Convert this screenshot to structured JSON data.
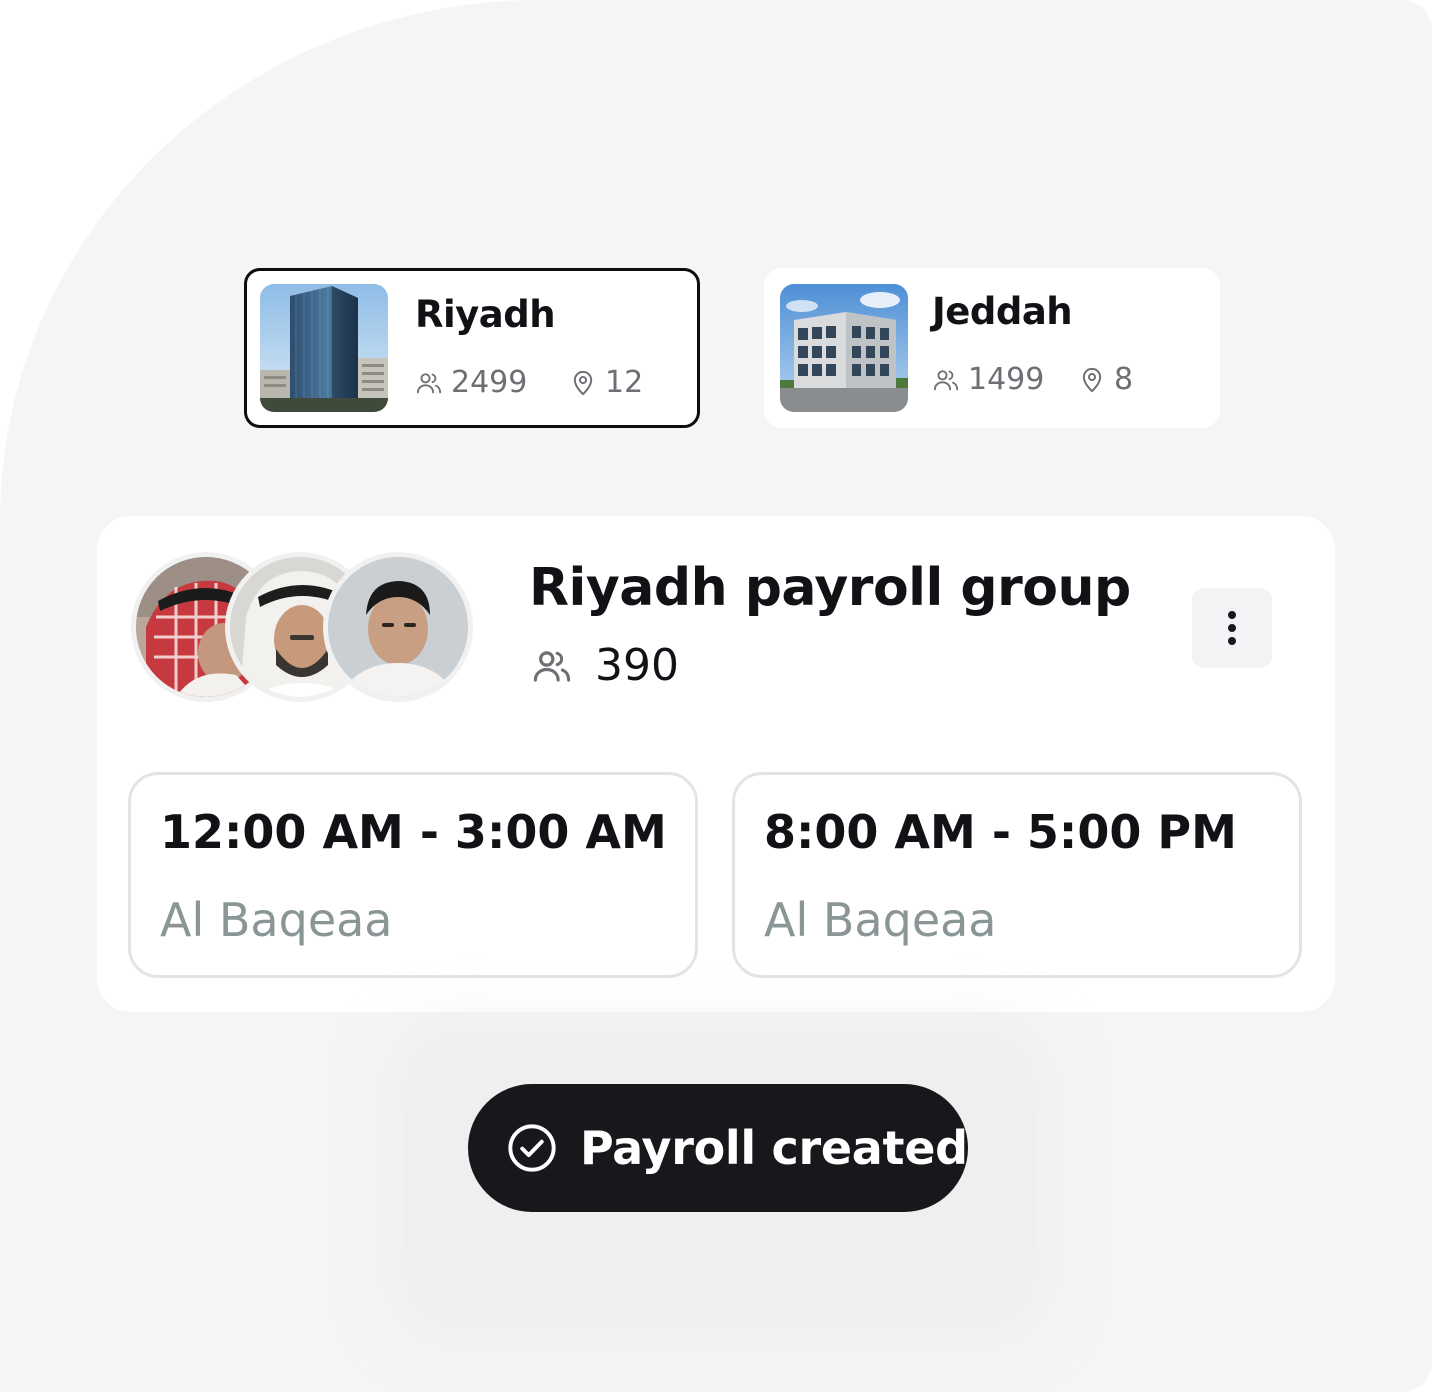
{
  "locations": [
    {
      "name": "Riyadh",
      "employees": "2499",
      "sites": "12",
      "selected": true,
      "image": "office-tower-photo"
    },
    {
      "name": "Jeddah",
      "employees": "1499",
      "sites": "8",
      "selected": false,
      "image": "office-building-photo"
    }
  ],
  "group": {
    "title": "Riyadh payroll group",
    "member_count": "390",
    "avatars": [
      "person-red-keffiyeh-photo",
      "person-white-ghutra-photo",
      "person-short-hair-photo"
    ],
    "menu_icon": "more-vertical-icon"
  },
  "shifts": [
    {
      "time": "12:00 AM - 3:00 AM",
      "place": "Al Baqeaa"
    },
    {
      "time": "8:00 AM - 5:00 PM",
      "place": "Al Baqeaa"
    }
  ],
  "toast": {
    "label": "Payroll created",
    "icon": "check-circle-icon"
  },
  "colors": {
    "background": "#f5f5f5",
    "card": "#ffffff",
    "text_primary": "#111216",
    "text_muted": "#8a9596",
    "toast_bg": "#17181c"
  }
}
